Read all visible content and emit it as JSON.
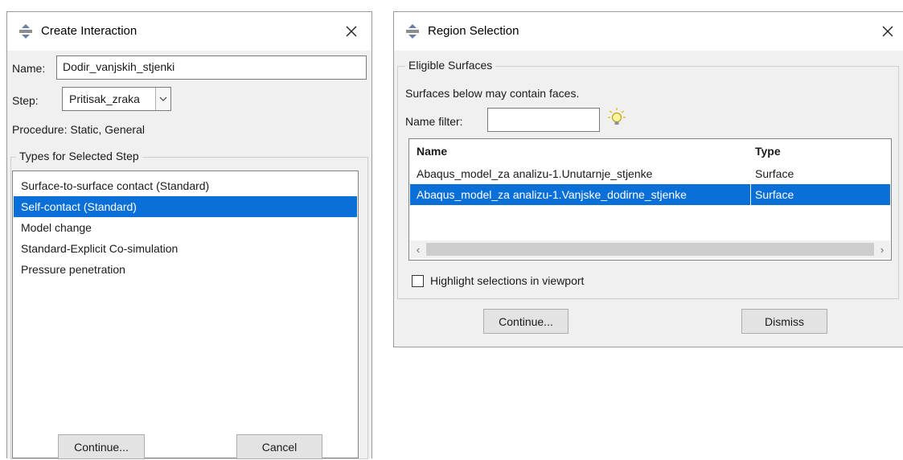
{
  "create_interaction": {
    "title": "Create Interaction",
    "close_icon": "close-icon",
    "name_label": "Name:",
    "name_value": "Dodir_vanjskih_stjenki",
    "step_label": "Step:",
    "step_value": "Pritisak_zraka",
    "procedure_text": "Procedure:  Static, General",
    "types_group_title": "Types for Selected Step",
    "types": [
      {
        "label": "Surface-to-surface contact (Standard)",
        "selected": false
      },
      {
        "label": "Self-contact (Standard)",
        "selected": true
      },
      {
        "label": "Model change",
        "selected": false
      },
      {
        "label": "Standard-Explicit Co-simulation",
        "selected": false
      },
      {
        "label": "Pressure penetration",
        "selected": false
      }
    ],
    "continue_label": "Continue...",
    "cancel_label": "Cancel"
  },
  "region_selection": {
    "title": "Region Selection",
    "eligible_group_title": "Eligible Surfaces",
    "info_text": "Surfaces below may contain faces.",
    "name_filter_label": "Name filter:",
    "name_filter_value": "",
    "hint_icon": "lightbulb-icon",
    "table": {
      "headers": [
        "Name",
        "Type"
      ],
      "rows": [
        [
          "Abaqus_model_za analizu-1.Unutarnje_stjenke",
          "Surface"
        ],
        [
          "Abaqus_model_za analizu-1.Vanjske_dodirne_stjenke",
          "Surface"
        ]
      ],
      "selected_row": 1
    },
    "highlight_label": "Highlight selections in viewport",
    "highlight_checked": false,
    "continue_label": "Continue...",
    "dismiss_label": "Dismiss"
  },
  "colors": {
    "selection": "#0a6fd6",
    "dialog_bg": "#f0f0f0",
    "titlebar_bg": "#ffffff"
  }
}
